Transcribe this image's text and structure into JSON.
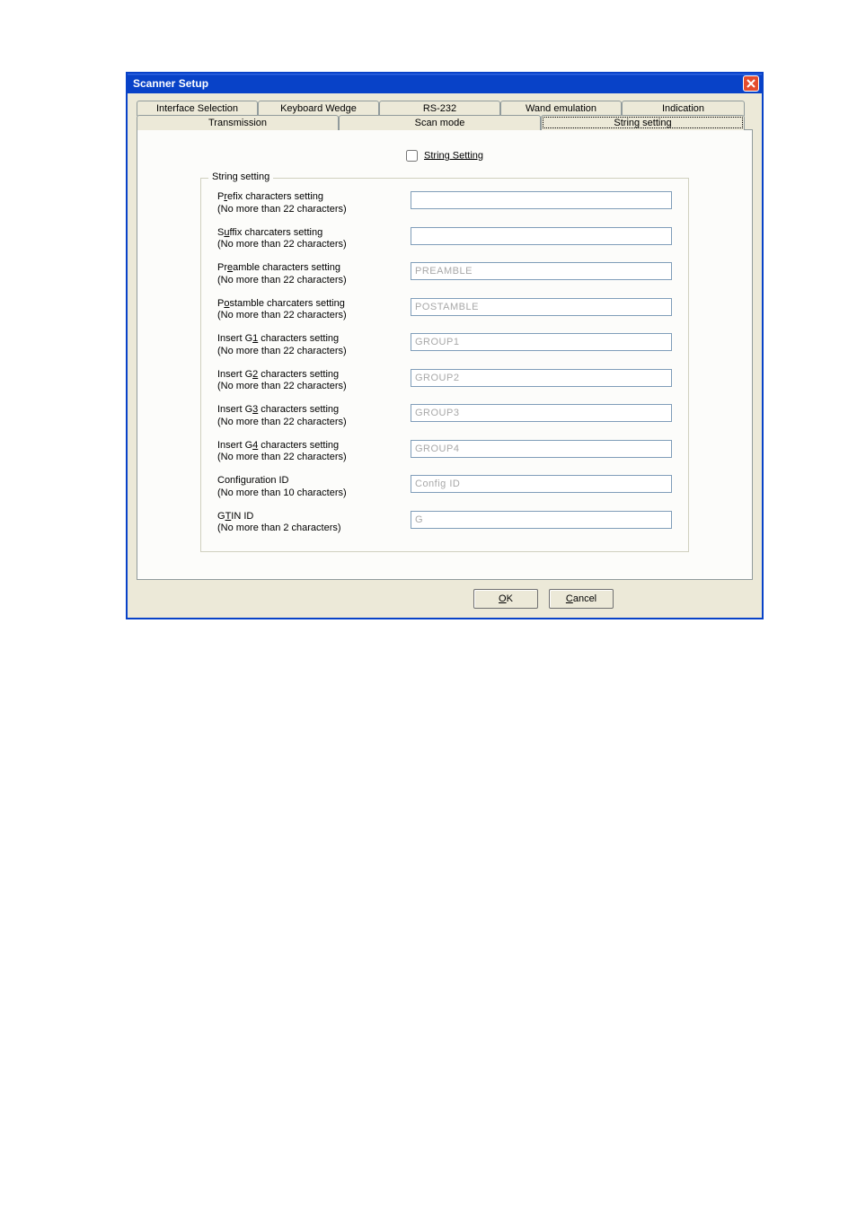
{
  "window": {
    "title": "Scanner Setup"
  },
  "tabs": {
    "row1": [
      {
        "label": "Interface Selection"
      },
      {
        "label": "Keyboard Wedge"
      },
      {
        "label": "RS-232"
      },
      {
        "label": "Wand emulation"
      },
      {
        "label": "Indication"
      }
    ],
    "row2": [
      {
        "label": "Transmission"
      },
      {
        "label": "Scan mode"
      },
      {
        "label": "String setting"
      }
    ],
    "active": "String setting"
  },
  "section": {
    "checkbox_label": "String Setting",
    "checkbox_checked": false,
    "group_title": "String setting",
    "rows": [
      {
        "label_html": "P<u>r</u>efix characters setting<br>(No  more than 22 characters)",
        "placeholder": "",
        "value": ""
      },
      {
        "label_html": "S<u>u</u>ffix charcaters setting<br>(No  more than 22 characters)",
        "placeholder": "",
        "value": ""
      },
      {
        "label_html": "Pr<u>e</u>amble characters setting<br>(No  more than 22 characters)",
        "placeholder": "PREAMBLE",
        "value": ""
      },
      {
        "label_html": "P<u>o</u>stamble charcaters setting<br>(No  more than 22 characters)",
        "placeholder": "POSTAMBLE",
        "value": ""
      },
      {
        "label_html": "Insert G<u>1</u> characters setting<br>(No  more than 22 characters)",
        "placeholder": "GROUP1",
        "value": ""
      },
      {
        "label_html": "Insert G<u>2</u> characters setting<br>(No  more than 22 characters)",
        "placeholder": "GROUP2",
        "value": ""
      },
      {
        "label_html": "Insert G<u>3</u> characters setting<br>(No  more than 22 characters)",
        "placeholder": "GROUP3",
        "value": ""
      },
      {
        "label_html": "Insert G<u>4</u> characters setting<br>(No  more than 22 characters)",
        "placeholder": "GROUP4",
        "value": ""
      },
      {
        "label_html": "Confi<u>g</u>uration ID<br>(No more than 10 characters)",
        "placeholder": "Config ID",
        "value": ""
      },
      {
        "label_html": "G<u>T</u>IN ID<br>(No  more than 2 characters)",
        "placeholder": "G",
        "value": ""
      }
    ]
  },
  "buttons": {
    "ok": "OK",
    "cancel": "Cancel"
  }
}
